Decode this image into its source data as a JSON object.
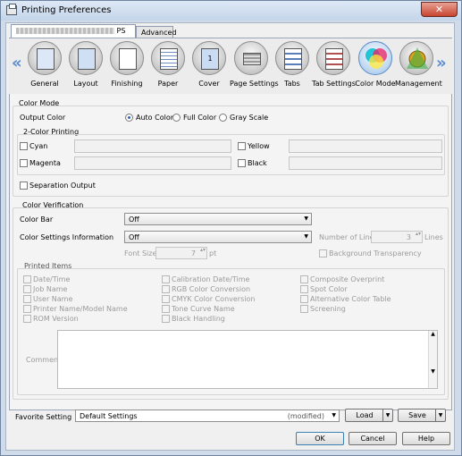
{
  "window": {
    "title": "Printing Preferences",
    "close": "✕"
  },
  "tabs": [
    "PS",
    "Advanced"
  ],
  "iconbar": {
    "items": [
      {
        "label": "General"
      },
      {
        "label": "Layout"
      },
      {
        "label": "Finishing"
      },
      {
        "label": "Paper"
      },
      {
        "label": "Cover"
      },
      {
        "label": "Page Settings"
      },
      {
        "label": "Tabs"
      },
      {
        "label": "Tab Settings"
      },
      {
        "label": "Color Mode",
        "selected": true
      },
      {
        "label": "Management"
      }
    ],
    "nav_left": "«",
    "nav_right": "»"
  },
  "color_mode": {
    "section": "Color Mode",
    "output_color_label": "Output Color",
    "options": [
      "Auto Color",
      "Full Color",
      "Gray Scale"
    ],
    "selected": "Auto Color",
    "two_color_title": "2-Color Printing",
    "two_color": [
      "Cyan",
      "Magenta",
      "Yellow",
      "Black"
    ],
    "separation": "Separation Output"
  },
  "verification": {
    "section": "Color Verification",
    "color_bar_label": "Color Bar",
    "color_bar_value": "Off",
    "csi_label": "Color Settings Information",
    "csi_value": "Off",
    "number_of_lines_label": "Number of Lines",
    "number_of_lines_value": "3",
    "lines_unit": "Lines",
    "font_size_label": "Font Size",
    "font_size_value": "7",
    "font_unit": "pt",
    "background_transparency": "Background Transparency"
  },
  "printed_items": {
    "title": "Printed Items",
    "col1": [
      "Date/Time",
      "Job Name",
      "User Name",
      "Printer Name/Model Name",
      "ROM Version"
    ],
    "col2": [
      "Calibration Date/Time",
      "RGB Color Conversion",
      "CMYK Color Conversion",
      "Tone Curve Name",
      "Black Handling"
    ],
    "col3": [
      "Composite Overprint",
      "Spot Color",
      "Alternative Color Table",
      "Screening"
    ],
    "comment_label": "Comment"
  },
  "favorite": {
    "label": "Favorite Setting",
    "value": "Default Settings",
    "modified": "(modified)",
    "load": "Load",
    "save": "Save"
  },
  "footer": {
    "ok": "OK",
    "cancel": "Cancel",
    "help": "Help"
  },
  "colors": {
    "selected_icon_bg": "#b9d4ef",
    "radio_dot": "#2a62c4",
    "title_bar": "#cfdbe9"
  }
}
